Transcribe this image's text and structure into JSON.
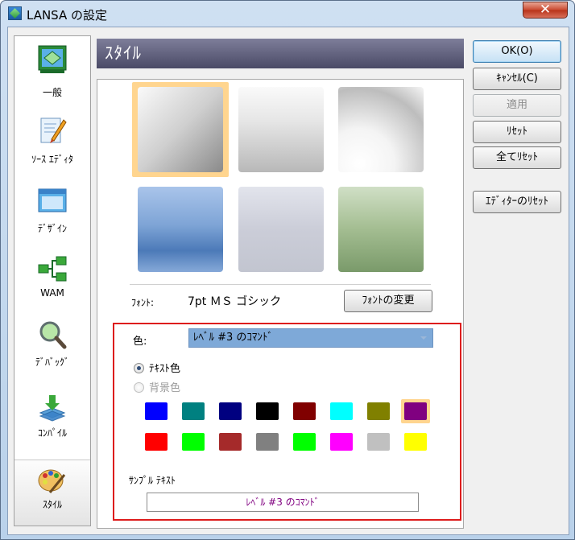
{
  "window": {
    "title": "LANSA の設定",
    "close_glyph": "✕"
  },
  "sidebar": {
    "items": [
      {
        "label": "一般",
        "icon": "general-icon"
      },
      {
        "label": "ｿｰｽ ｴﾃﾞｨﾀ",
        "icon": "source-editor-icon"
      },
      {
        "label": "ﾃﾞｻﾞｲﾝ",
        "icon": "design-icon"
      },
      {
        "label": "WAM",
        "icon": "wam-icon"
      },
      {
        "label": "ﾃﾞﾊﾞｯｸﾞ",
        "icon": "debug-icon"
      },
      {
        "label": "ｺﾝﾊﾟｲﾙ",
        "icon": "compile-icon"
      },
      {
        "label": "ｽﾀｲﾙ",
        "icon": "style-icon",
        "selected": true
      }
    ]
  },
  "header": {
    "title": "ｽﾀｲﾙ"
  },
  "styles": {
    "selected_index": 0
  },
  "font": {
    "label": "ﾌｫﾝﾄ:",
    "value": "7pt ＭＳ ゴシック",
    "change_button": "ﾌｫﾝﾄの変更"
  },
  "color_section": {
    "label": "色:",
    "selected_item": "ﾚﾍﾞﾙ #3 のｺﾏﾝﾄﾞ",
    "radio_text": "ﾃｷｽﾄ色",
    "radio_background": "背景色",
    "palette": [
      "#0000ff",
      "#008080",
      "#000080",
      "#000000",
      "#800000",
      "#00ffff",
      "#808000",
      "#800080",
      "#ff0000",
      "#00ff00",
      "#a52a2a",
      "#808080",
      "#00ff00",
      "#ff00ff",
      "#c0c0c0",
      "#ffff00"
    ],
    "selected_color": "#800080",
    "sample_label": "ｻﾝﾌﾟﾙ ﾃｷｽﾄ",
    "sample_text": "ﾚﾍﾞﾙ #3 のｺﾏﾝﾄﾞ"
  },
  "buttons": {
    "ok": "OK(O)",
    "cancel": "ｷｬﾝｾﾙ(C)",
    "apply": "適用",
    "reset": "ﾘｾｯﾄ",
    "reset_all": "全てﾘｾｯﾄ",
    "reset_editor": "ｴﾃﾞｨﾀｰのﾘｾｯﾄ"
  }
}
